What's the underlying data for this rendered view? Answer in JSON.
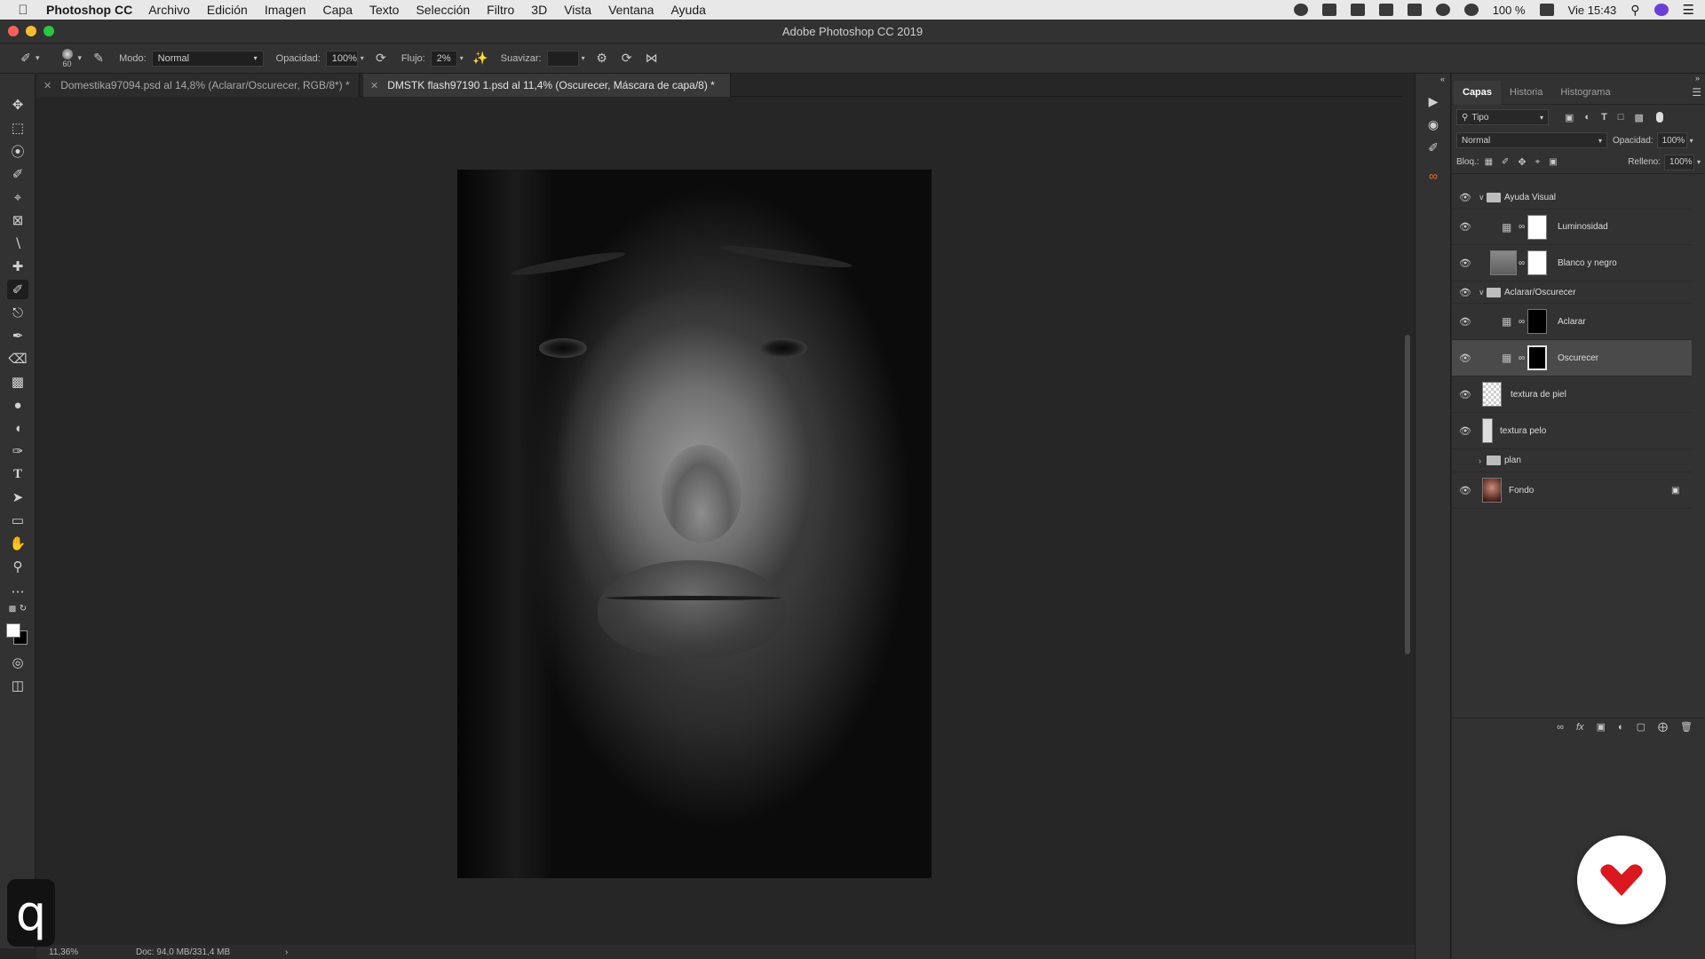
{
  "menubar": {
    "app_name": "Photoshop CC",
    "items": [
      "Archivo",
      "Edición",
      "Imagen",
      "Capa",
      "Texto",
      "Selección",
      "Filtro",
      "3D",
      "Vista",
      "Ventana",
      "Ayuda"
    ],
    "battery": "100 %",
    "clock": "Vie 15:43"
  },
  "window": {
    "title": "Adobe Photoshop CC 2019"
  },
  "options": {
    "brush_size": "60",
    "mode_label": "Modo:",
    "mode_value": "Normal",
    "opacity_label": "Opacidad:",
    "opacity_value": "100%",
    "flow_label": "Flujo:",
    "flow_value": "2%",
    "smoothing_label": "Suavizar:",
    "smoothing_value": ""
  },
  "tabs": [
    {
      "label": "Domestika97094.psd al 14,8% (Aclarar/Oscurecer, RGB/8*) *",
      "active": false
    },
    {
      "label": "DMSTK flash97190 1.psd al 11,4% (Oscurecer, Máscara de capa/8) *",
      "active": true
    }
  ],
  "status": {
    "zoom": "11,36%",
    "doc": "Doc: 94,0 MB/331,4 MB"
  },
  "layers_panel": {
    "tabs": [
      "Capas",
      "Historia",
      "Histograma"
    ],
    "active_tab": "Capas",
    "filter_value": "Tipo",
    "blend_mode": "Normal",
    "opacity_label": "Opacidad:",
    "opacity_value": "100%",
    "lock_label": "Bloq.:",
    "fill_label": "Relleno:",
    "fill_value": "100%",
    "layers": [
      {
        "name": "Ayuda Visual",
        "kind": "group",
        "expanded": true,
        "visible": true
      },
      {
        "name": "Luminosidad",
        "kind": "adjustment",
        "mask": "white",
        "visible": true
      },
      {
        "name": "Blanco y negro",
        "kind": "adjustment",
        "mask": "white",
        "visible": true
      },
      {
        "name": "Aclarar/Oscurecer",
        "kind": "group",
        "expanded": true,
        "visible": true
      },
      {
        "name": "Aclarar",
        "kind": "adjustment",
        "mask": "black",
        "visible": true
      },
      {
        "name": "Oscurecer",
        "kind": "adjustment",
        "mask": "black",
        "visible": true,
        "selected": true
      },
      {
        "name": "textura de piel",
        "kind": "pixel",
        "visible": true
      },
      {
        "name": "textura pelo",
        "kind": "pixel",
        "visible": true
      },
      {
        "name": "plan",
        "kind": "group",
        "expanded": false,
        "visible": false
      },
      {
        "name": "Fondo",
        "kind": "background",
        "locked": true,
        "visible": true
      }
    ]
  },
  "watermark": {
    "letter": "q"
  },
  "colors": {
    "accent_heart": "#d9181f",
    "foreground": "#ffffff",
    "background": "#000000"
  }
}
